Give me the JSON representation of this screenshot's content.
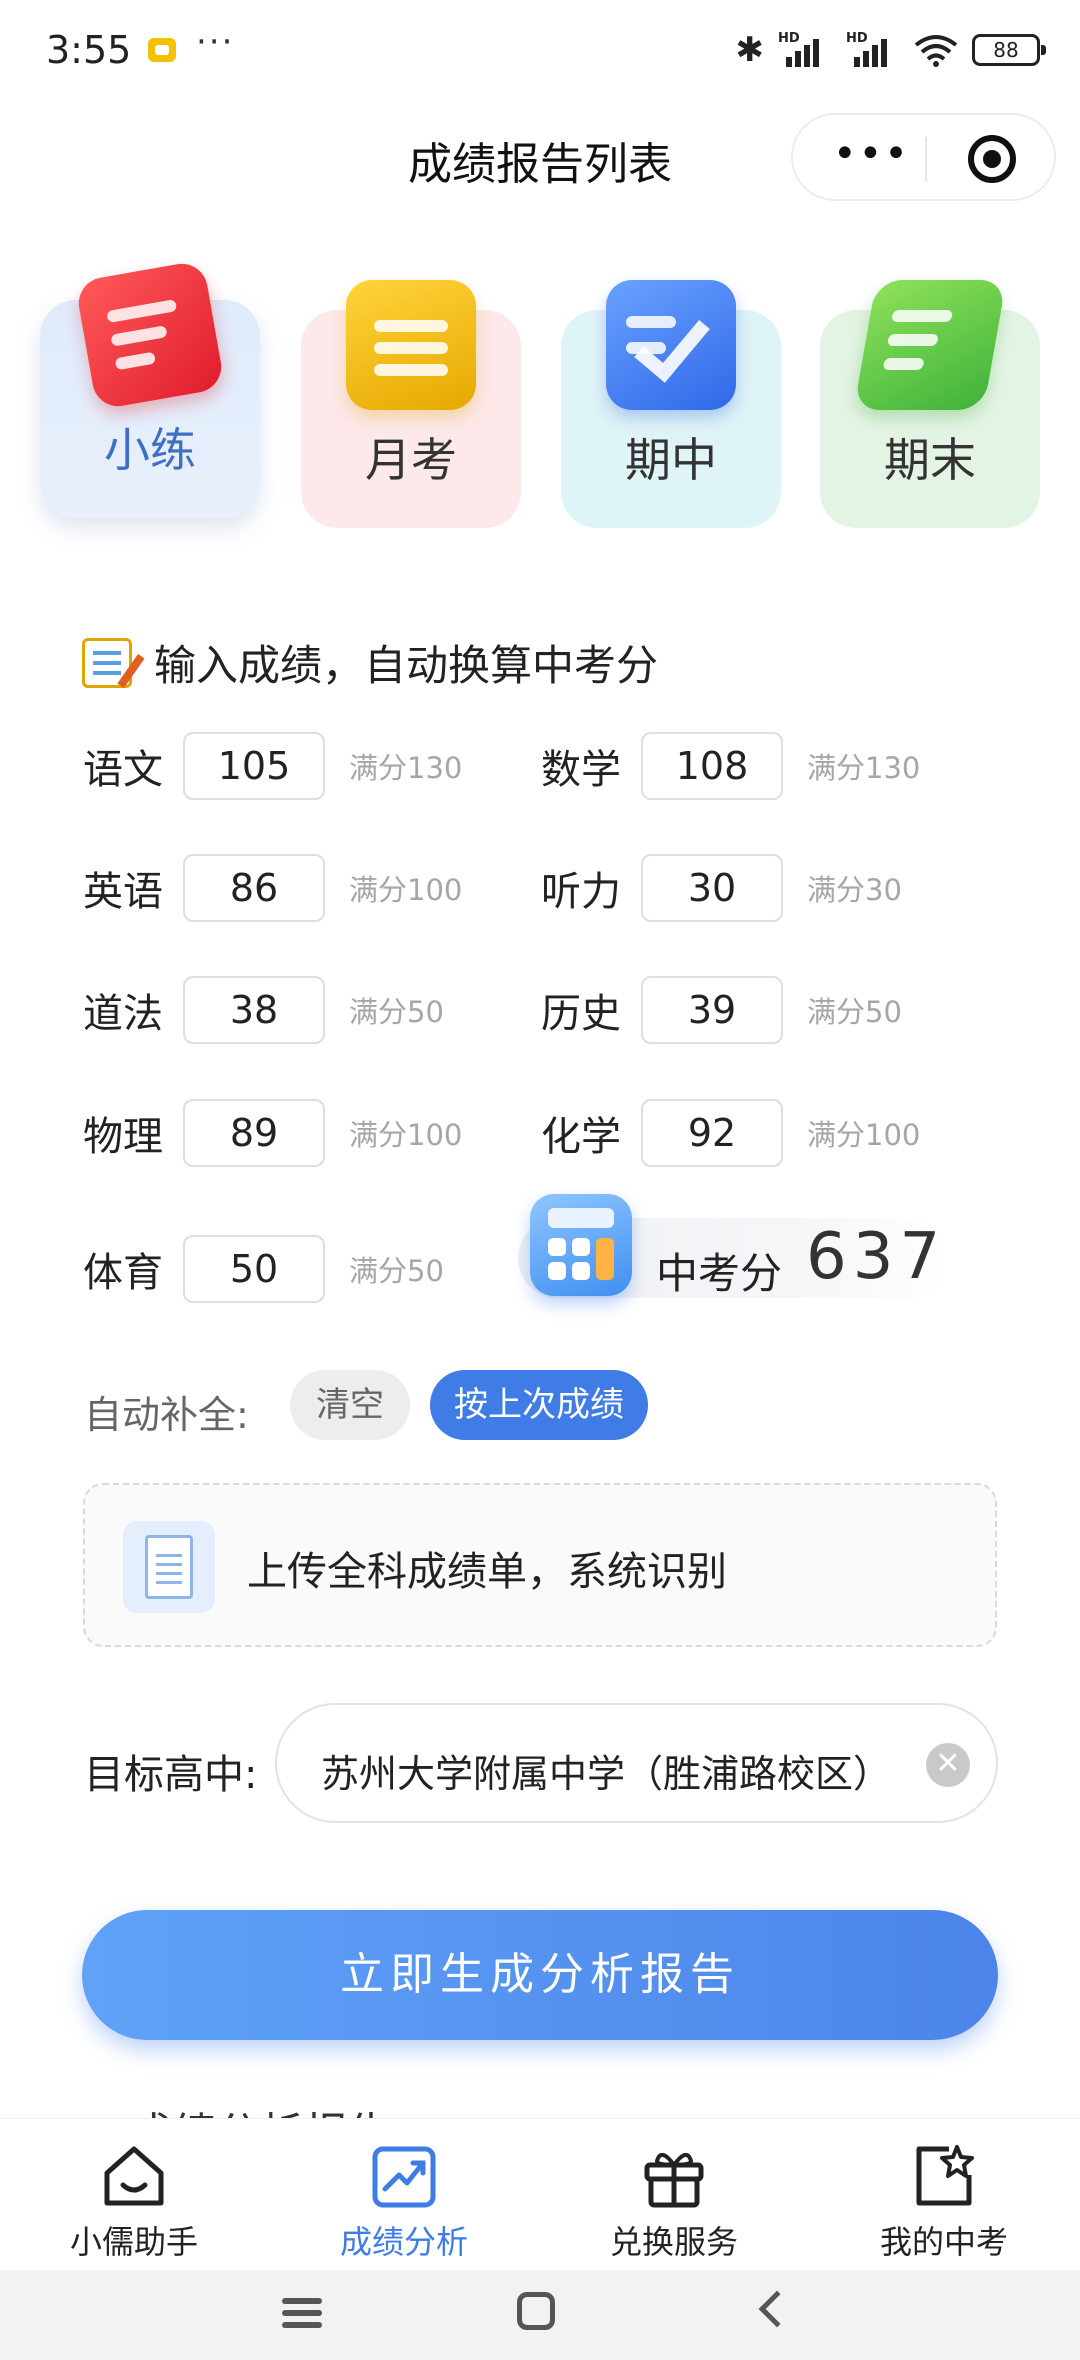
{
  "status_bar": {
    "time": "3:55",
    "more": "···",
    "battery": "88",
    "hd": "HD"
  },
  "nav": {
    "title": "成绩报告列表",
    "more_glyph": "•••"
  },
  "exam_types": [
    {
      "label": "小练"
    },
    {
      "label": "月考"
    },
    {
      "label": "期中"
    },
    {
      "label": "期末"
    }
  ],
  "section": {
    "title": "输入成绩，自动换算中考分"
  },
  "scores": [
    {
      "subject": "语文",
      "value": "105",
      "full": "满分130"
    },
    {
      "subject": "数学",
      "value": "108",
      "full": "满分130"
    },
    {
      "subject": "英语",
      "value": "86",
      "full": "满分100"
    },
    {
      "subject": "听力",
      "value": "30",
      "full": "满分30"
    },
    {
      "subject": "道法",
      "value": "38",
      "full": "满分50"
    },
    {
      "subject": "历史",
      "value": "39",
      "full": "满分50"
    },
    {
      "subject": "物理",
      "value": "89",
      "full": "满分100"
    },
    {
      "subject": "化学",
      "value": "92",
      "full": "满分100"
    },
    {
      "subject": "体育",
      "value": "50",
      "full": "满分50"
    }
  ],
  "total": {
    "label": "中考分",
    "value": "637"
  },
  "autofill": {
    "label": "自动补全:",
    "clear": "清空",
    "last": "按上次成绩"
  },
  "upload": {
    "text": "上传全科成绩单，系统识别"
  },
  "target": {
    "label": "目标高中:",
    "value": "苏州大学附属中学（胜浦路校区）",
    "clear_glyph": "✕"
  },
  "generate": {
    "label": "立即生成分析报告"
  },
  "peek": {
    "text": "成绩分析报告"
  },
  "tabs": [
    {
      "label": "小儒助手"
    },
    {
      "label": "成绩分析"
    },
    {
      "label": "兑换服务"
    },
    {
      "label": "我的中考"
    }
  ],
  "colors": {
    "accent": "#3f7ce5",
    "button_start": "#5fa2f7",
    "button_end": "#4c84ea"
  }
}
